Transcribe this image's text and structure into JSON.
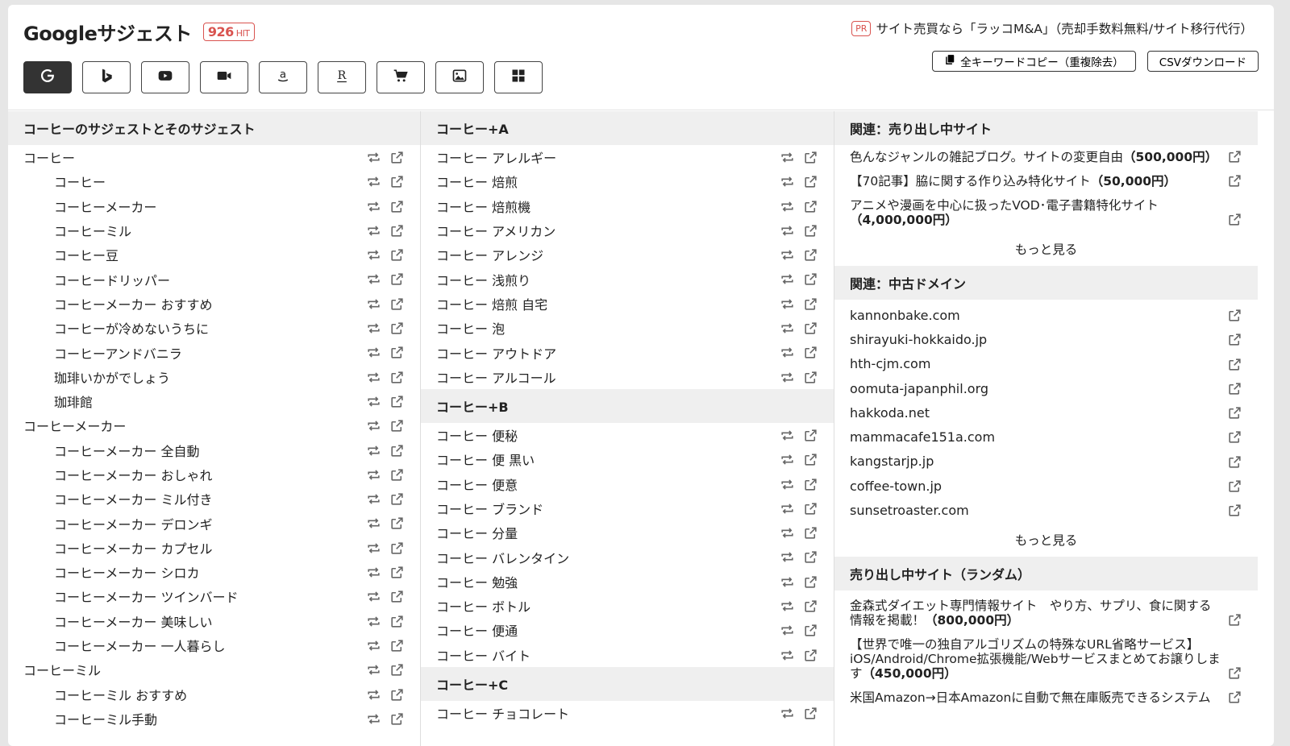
{
  "header": {
    "title": "Googleサジェスト",
    "hit_count": "926",
    "hit_unit": "HIT",
    "pr_badge": "PR",
    "pr_text": "サイト売買なら「ラッコM&A」（売却手数料無料/サイト移行代行）",
    "copy_button": "全キーワードコピー（重複除去）",
    "csv_button": "CSVダウンロード"
  },
  "toolbar": {
    "buttons": [
      "google-icon",
      "bing-icon",
      "youtube-icon",
      "video-icon",
      "amazon-icon",
      "rakuten-icon",
      "cart-icon",
      "image-icon",
      "grid-icon"
    ],
    "active": "google-icon"
  },
  "col1": {
    "heading": "コーヒーのサジェストとそのサジェスト",
    "rows": [
      {
        "text": "コーヒー",
        "level": 0
      },
      {
        "text": "コーヒー",
        "level": 1
      },
      {
        "text": "コーヒーメーカー",
        "level": 1
      },
      {
        "text": "コーヒーミル",
        "level": 1
      },
      {
        "text": "コーヒー豆",
        "level": 1
      },
      {
        "text": "コーヒードリッパー",
        "level": 1
      },
      {
        "text": "コーヒーメーカー おすすめ",
        "level": 1
      },
      {
        "text": "コーヒーが冷めないうちに",
        "level": 1
      },
      {
        "text": "コーヒーアンドバニラ",
        "level": 1
      },
      {
        "text": "珈琲いかがでしょう",
        "level": 1
      },
      {
        "text": "珈琲館",
        "level": 1
      },
      {
        "text": "コーヒーメーカー",
        "level": 0
      },
      {
        "text": "コーヒーメーカー 全自動",
        "level": 1
      },
      {
        "text": "コーヒーメーカー おしゃれ",
        "level": 1
      },
      {
        "text": "コーヒーメーカー ミル付き",
        "level": 1
      },
      {
        "text": "コーヒーメーカー デロンギ",
        "level": 1
      },
      {
        "text": "コーヒーメーカー カプセル",
        "level": 1
      },
      {
        "text": "コーヒーメーカー シロカ",
        "level": 1
      },
      {
        "text": "コーヒーメーカー ツインバード",
        "level": 1
      },
      {
        "text": "コーヒーメーカー 美味しい",
        "level": 1
      },
      {
        "text": "コーヒーメーカー 一人暮らし",
        "level": 1
      },
      {
        "text": "コーヒーミル",
        "level": 0
      },
      {
        "text": "コーヒーミル おすすめ",
        "level": 1
      },
      {
        "text": "コーヒーミル手動",
        "level": 1
      }
    ]
  },
  "col2": {
    "sections": [
      {
        "heading": "コーヒー+A",
        "rows": [
          "コーヒー アレルギー",
          "コーヒー 焙煎",
          "コーヒー 焙煎機",
          "コーヒー アメリカン",
          "コーヒー アレンジ",
          "コーヒー 浅煎り",
          "コーヒー 焙煎 自宅",
          "コーヒー 泡",
          "コーヒー アウトドア",
          "コーヒー アルコール"
        ]
      },
      {
        "heading": "コーヒー+B",
        "rows": [
          "コーヒー 便秘",
          "コーヒー 便 黒い",
          "コーヒー 便意",
          "コーヒー ブランド",
          "コーヒー 分量",
          "コーヒー バレンタイン",
          "コーヒー 勉強",
          "コーヒー ボトル",
          "コーヒー 便通",
          "コーヒー バイト"
        ]
      },
      {
        "heading": "コーヒー+C",
        "rows": [
          "コーヒー チョコレート"
        ]
      }
    ]
  },
  "col3": {
    "sale_sites": {
      "heading": "関連：売り出し中サイト",
      "items": [
        {
          "text": "色んなジャンルの雑記ブログ。サイトの変更自由",
          "price": "（500,000円）"
        },
        {
          "text": "【70記事】脇に関する作り込み特化サイト",
          "price": "（50,000円）"
        },
        {
          "text": "アニメや漫画を中心に扱ったVOD･電子書籍特化サイト",
          "price": "（4,000,000円）"
        }
      ],
      "more": "もっと見る"
    },
    "domains": {
      "heading": "関連：中古ドメイン",
      "items": [
        "kannonbake.com",
        "shirayuki-hokkaido.jp",
        "hth-cjm.com",
        "oomuta-japanphil.org",
        "hakkoda.net",
        "mammacafe151a.com",
        "kangstarjp.jp",
        "coffee-town.jp",
        "sunsetroaster.com"
      ],
      "more": "もっと見る"
    },
    "random_sites": {
      "heading": "売り出し中サイト（ランダム）",
      "items": [
        {
          "text": "金森式ダイエット専門情報サイト　やり方、サプリ、食に関する情報を掲載！",
          "price": "（800,000円）"
        },
        {
          "text": "【世界で唯一の独自アルゴリズムの特殊なURL省略サービス】iOS/Android/Chrome拡張機能/Webサービスまとめてお譲りします",
          "price": "（450,000円）"
        },
        {
          "text": "米国Amazon→日本Amazonに自動で無在庫販売できるシステム",
          "price": ""
        }
      ]
    }
  }
}
